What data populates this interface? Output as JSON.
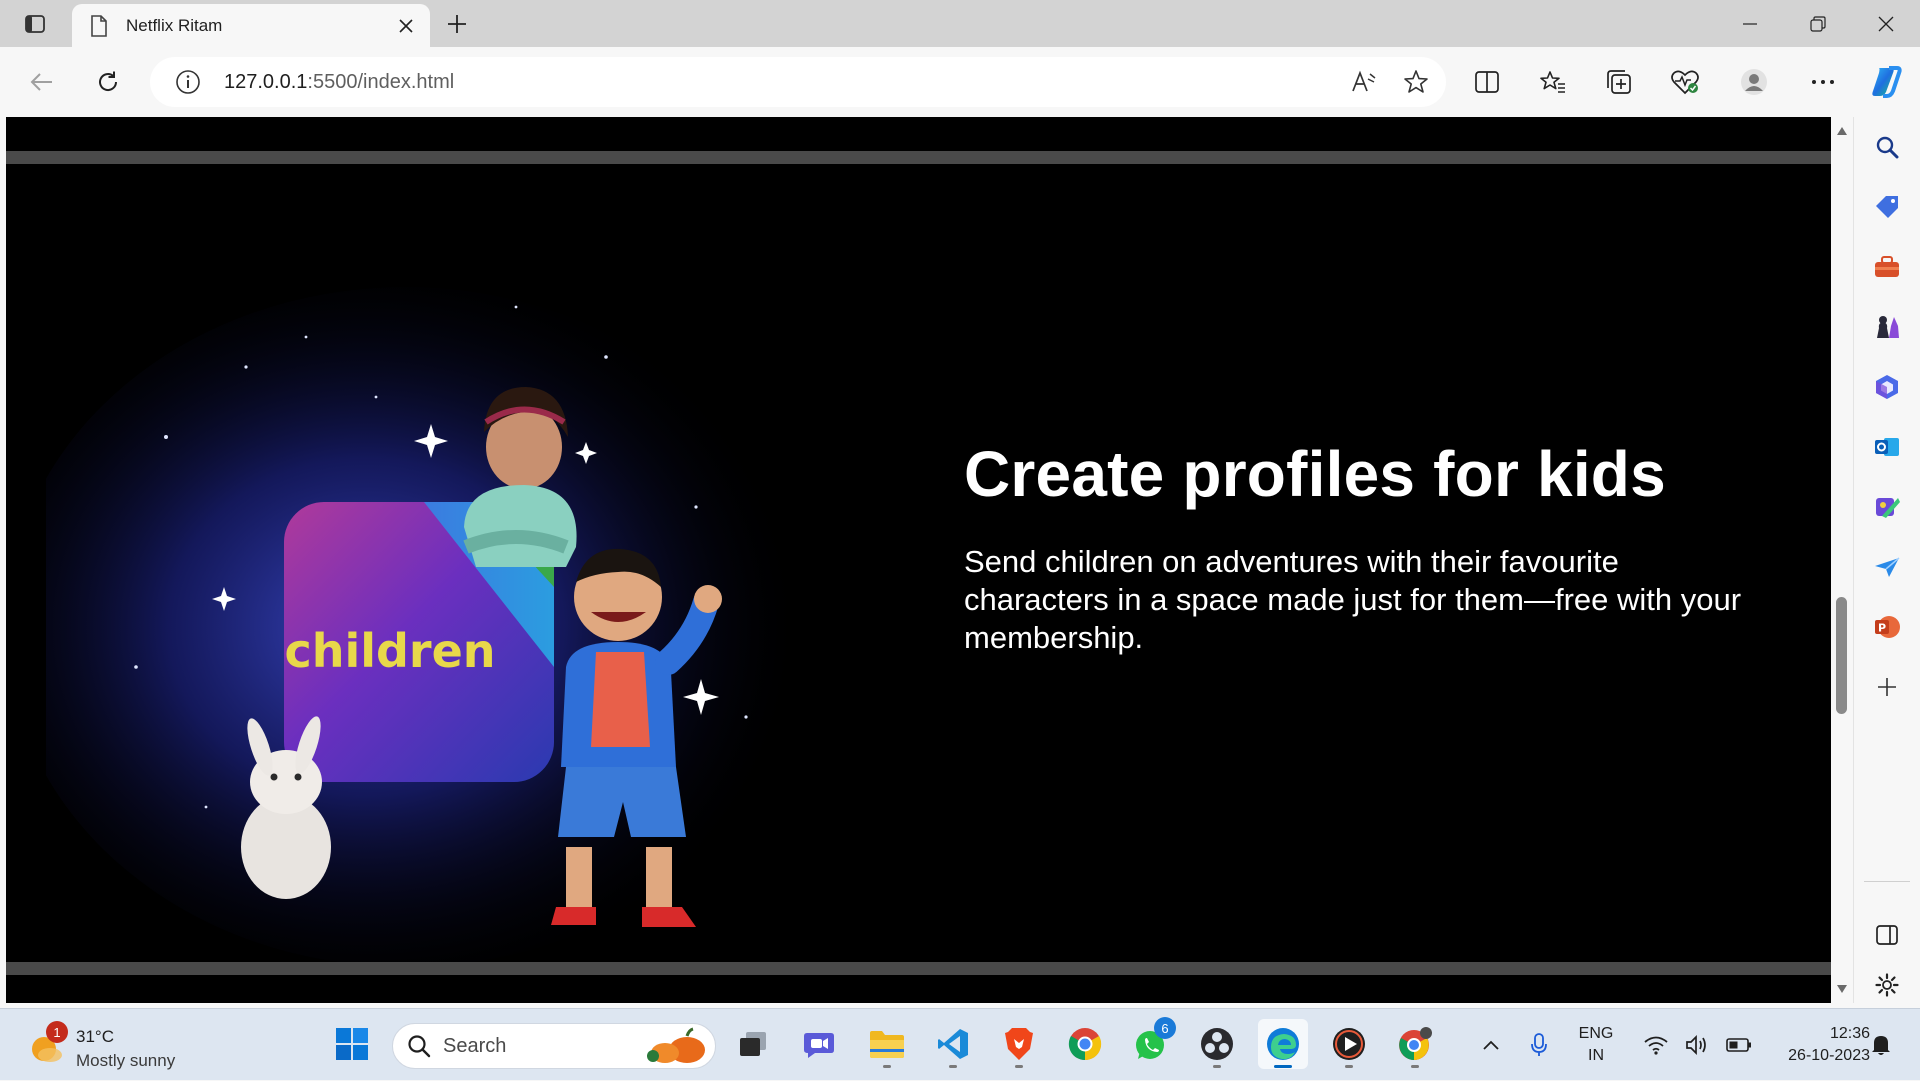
{
  "browser": {
    "tab_title": "Netflix Ritam",
    "url_host": "127.0.0.1",
    "url_path": ":5500/index.html"
  },
  "page": {
    "hero_title": "Create profiles for kids",
    "hero_description": "Send children on adventures with their favourite characters in a space made just for them—free with your membership.",
    "hero_image_label": "children"
  },
  "sidebar": {
    "items": [
      "search-icon",
      "shopping-tag-icon",
      "tools-icon",
      "games-icon",
      "microsoft365-icon",
      "outlook-icon",
      "designer-icon",
      "send-icon",
      "powerpoint-icon",
      "add-icon"
    ]
  },
  "taskbar": {
    "weather_temp": "31°C",
    "weather_condition": "Mostly sunny",
    "weather_badge": "1",
    "search_label": "Search",
    "whatsapp_badge": "6",
    "lang_line1": "ENG",
    "lang_line2": "IN",
    "time": "12:36",
    "date": "26-10-2023"
  },
  "colors": {
    "page_bg": "#000000",
    "band": "#4a4a4a",
    "hero_text": "#ffffff",
    "accent": "#0067c0"
  }
}
